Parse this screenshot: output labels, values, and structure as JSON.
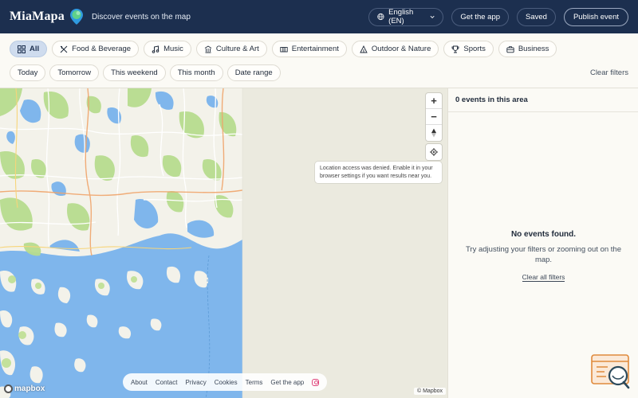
{
  "header": {
    "logo": "MiaMapa",
    "tagline": "Discover events on the map",
    "language": "English (EN)",
    "get_app": "Get the app",
    "saved": "Saved",
    "publish": "Publish event"
  },
  "categories": [
    {
      "label": "All",
      "icon": "grid-icon",
      "active": true
    },
    {
      "label": "Food & Beverage",
      "icon": "utensils-icon"
    },
    {
      "label": "Music",
      "icon": "music-note-icon"
    },
    {
      "label": "Culture & Art",
      "icon": "museum-icon"
    },
    {
      "label": "Entertainment",
      "icon": "ticket-icon"
    },
    {
      "label": "Outdoor & Nature",
      "icon": "tent-icon"
    },
    {
      "label": "Sports",
      "icon": "trophy-icon"
    },
    {
      "label": "Business",
      "icon": "briefcase-icon"
    }
  ],
  "dates": [
    "Today",
    "Tomorrow",
    "This weekend",
    "This month",
    "Date range"
  ],
  "clear_filters": "Clear filters",
  "map": {
    "zoom_in": "+",
    "zoom_out": "−",
    "location_notice": "Location access was denied. Enable it in your browser settings if you want results near you.",
    "mapbox": "mapbox",
    "attribution": "© Mapbox",
    "footer_links": [
      "About",
      "Contact",
      "Privacy",
      "Cookies",
      "Terms",
      "Get the app"
    ]
  },
  "panel": {
    "count_title": "0 events in this area",
    "empty_title": "No events found.",
    "empty_sub": "Try adjusting your filters or zooming out on the map.",
    "clear_all": "Clear all filters"
  },
  "colors": {
    "header_bg": "#1c2f4f",
    "water": "#7fb6ec",
    "land": "#f4f3ec",
    "park": "#b7dc8f",
    "active_chip": "#cfdcee"
  }
}
